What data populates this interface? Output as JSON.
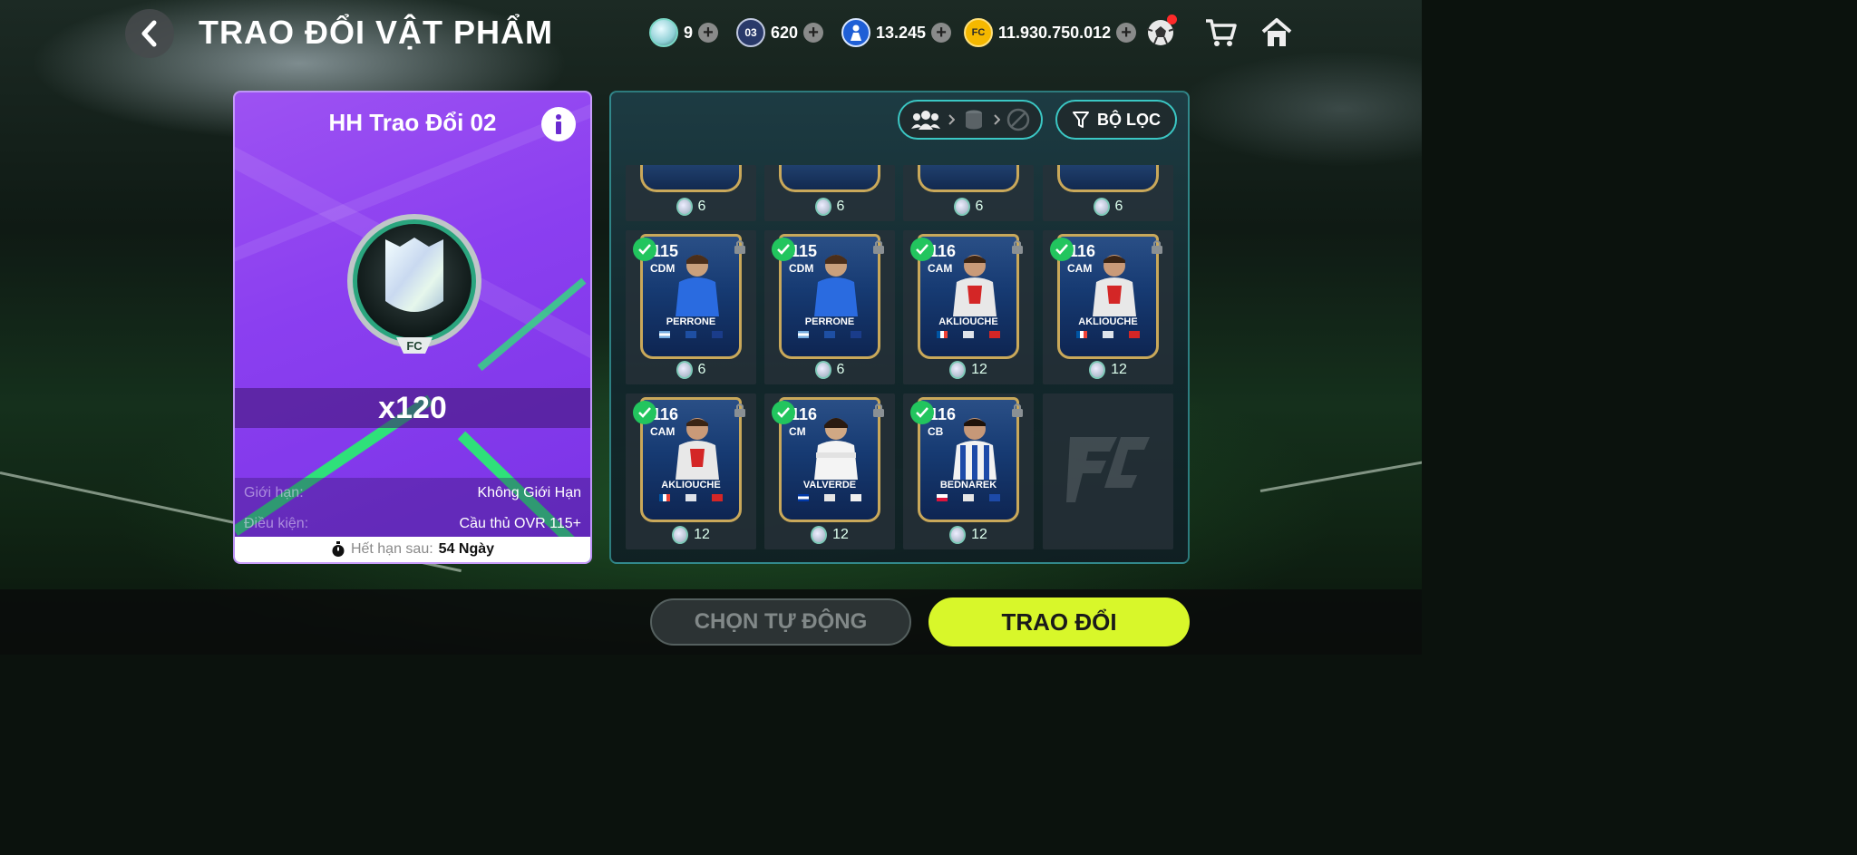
{
  "header": {
    "title": "TRAO ĐỔI VẬT PHẨM",
    "currencies": [
      {
        "icon": "silver-badge-icon",
        "value": "9"
      },
      {
        "icon": "ticket-03-icon",
        "value": "620",
        "icon_text": "03"
      },
      {
        "icon": "player-coin-icon",
        "value": "13.245"
      },
      {
        "icon": "fc-coin-icon",
        "value": "11.930.750.012"
      }
    ]
  },
  "offer": {
    "title": "HH Trao Đổi 02",
    "quantity": "x120",
    "limit_label": "Giới hạn:",
    "limit_value": "Không Giới Hạn",
    "condition_label": "Điều kiện:",
    "condition_value": "Cầu thủ OVR 115+",
    "expire_label": "Hết hạn sau:",
    "expire_value": "54 Ngày"
  },
  "panel": {
    "filter_label": "BỘ LỌC",
    "top_row_costs": [
      "6",
      "6",
      "6",
      "6"
    ],
    "players": [
      {
        "ovr": "115",
        "pos": "CDM",
        "name": "PERRONE",
        "cost": "6",
        "selected": true
      },
      {
        "ovr": "115",
        "pos": "CDM",
        "name": "PERRONE",
        "cost": "6",
        "selected": true
      },
      {
        "ovr": "116",
        "pos": "CAM",
        "name": "AKLIOUCHE",
        "cost": "12",
        "selected": true
      },
      {
        "ovr": "116",
        "pos": "CAM",
        "name": "AKLIOUCHE",
        "cost": "12",
        "selected": true
      },
      {
        "ovr": "116",
        "pos": "CAM",
        "name": "AKLIOUCHE",
        "cost": "12",
        "selected": true
      },
      {
        "ovr": "116",
        "pos": "CM",
        "name": "VALVERDE",
        "cost": "12",
        "selected": true
      },
      {
        "ovr": "116",
        "pos": "CB",
        "name": "BEDNAREK",
        "cost": "12",
        "selected": true
      }
    ]
  },
  "buttons": {
    "auto_select": "CHỌN TỰ ĐỘNG",
    "trade": "TRAO ĐỔI"
  },
  "colors": {
    "accent_lime": "#d8f72a",
    "card_purple": "#8b3ff0",
    "check_green": "#22c55e",
    "panel_border": "#3bc7c4"
  }
}
